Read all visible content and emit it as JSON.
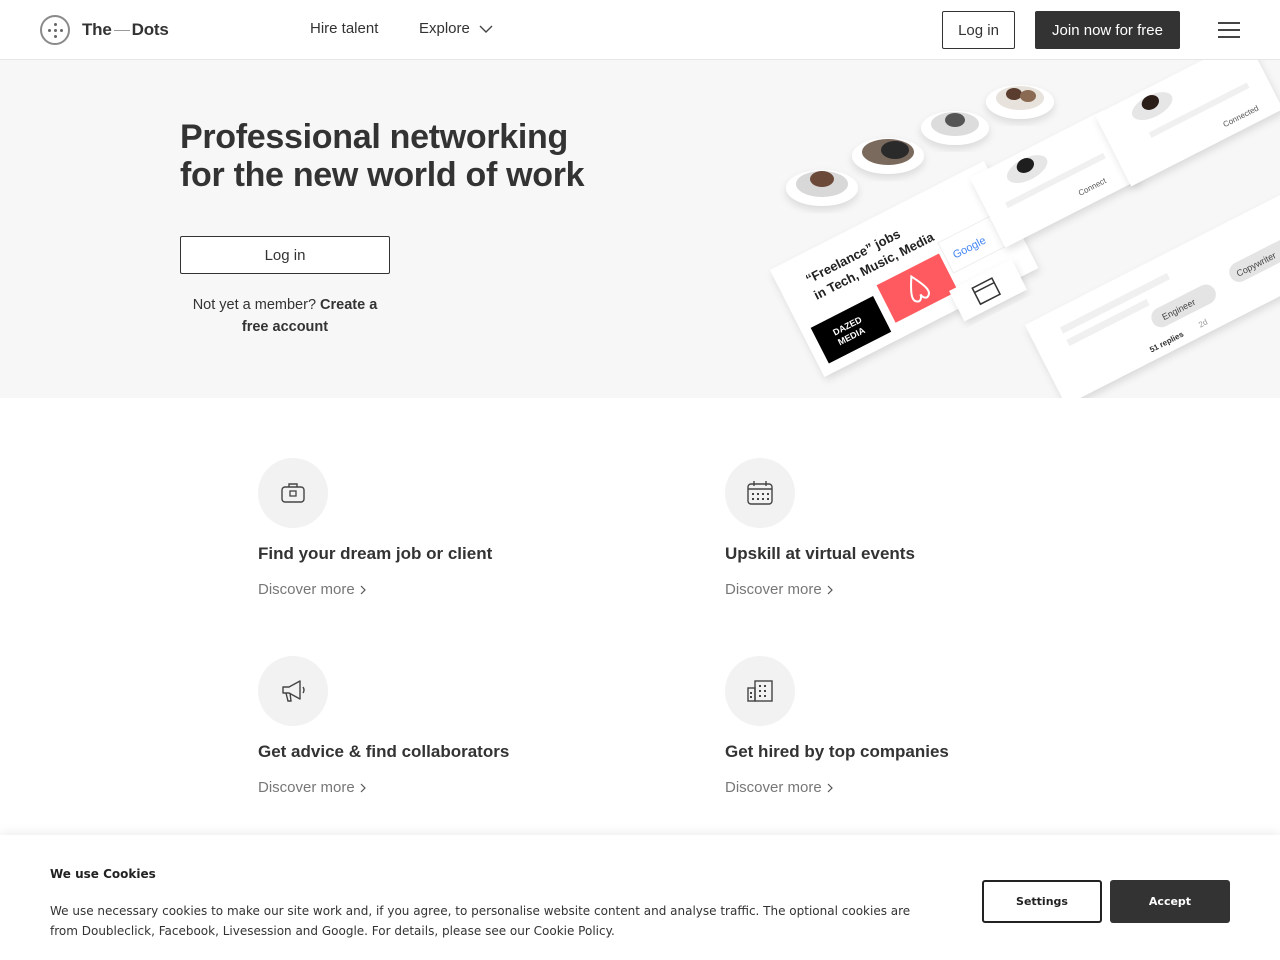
{
  "header": {
    "logo_text_left": "The",
    "logo_text_right": "Dots",
    "nav": {
      "hire_talent": "Hire talent",
      "explore": "Explore"
    },
    "login_label": "Log in",
    "join_label": "Join now for free"
  },
  "hero": {
    "title": "Professional networking for the new world of work",
    "login_label": "Log in",
    "member_prompt": "Not yet a member?",
    "create_account": "Create a free account",
    "illustration": {
      "jobs_card_text_line1": "“Freelance” jobs",
      "jobs_card_text_line2": "in Tech, Music, Media",
      "dazed_logo_line1": "DAZED",
      "dazed_logo_line2": "MEDIA",
      "google_logo": "Google",
      "connected_label": "Connected",
      "connect_label": "Connect",
      "tag_engineer": "Engineer",
      "tag_copywriter": "Copywriter",
      "replies_text": "51 replies",
      "replies_time": "2d"
    }
  },
  "features": [
    {
      "title": "Find your dream job or client",
      "link": "Discover more",
      "icon": "briefcase-icon"
    },
    {
      "title": "Upskill at virtual events",
      "link": "Discover more",
      "icon": "calendar-icon"
    },
    {
      "title": "Get advice & find collaborators",
      "link": "Discover more",
      "icon": "megaphone-icon"
    },
    {
      "title": "Get hired by top companies",
      "link": "Discover more",
      "icon": "building-icon"
    }
  ],
  "cookie": {
    "title": "We use Cookies",
    "body": "We use necessary cookies to make our site work and, if you agree, to personalise website content and analyse traffic. The optional cookies are from Doubleclick, Facebook, Livesession and Google. For details, please see our Cookie Policy.",
    "settings_label": "Settings",
    "accept_label": "Accept"
  },
  "colors": {
    "primary_dark": "#333333",
    "hero_bg": "#f7f7f7",
    "airbnb": "#ff5a5f",
    "icon_bg": "#f2f2f2"
  }
}
